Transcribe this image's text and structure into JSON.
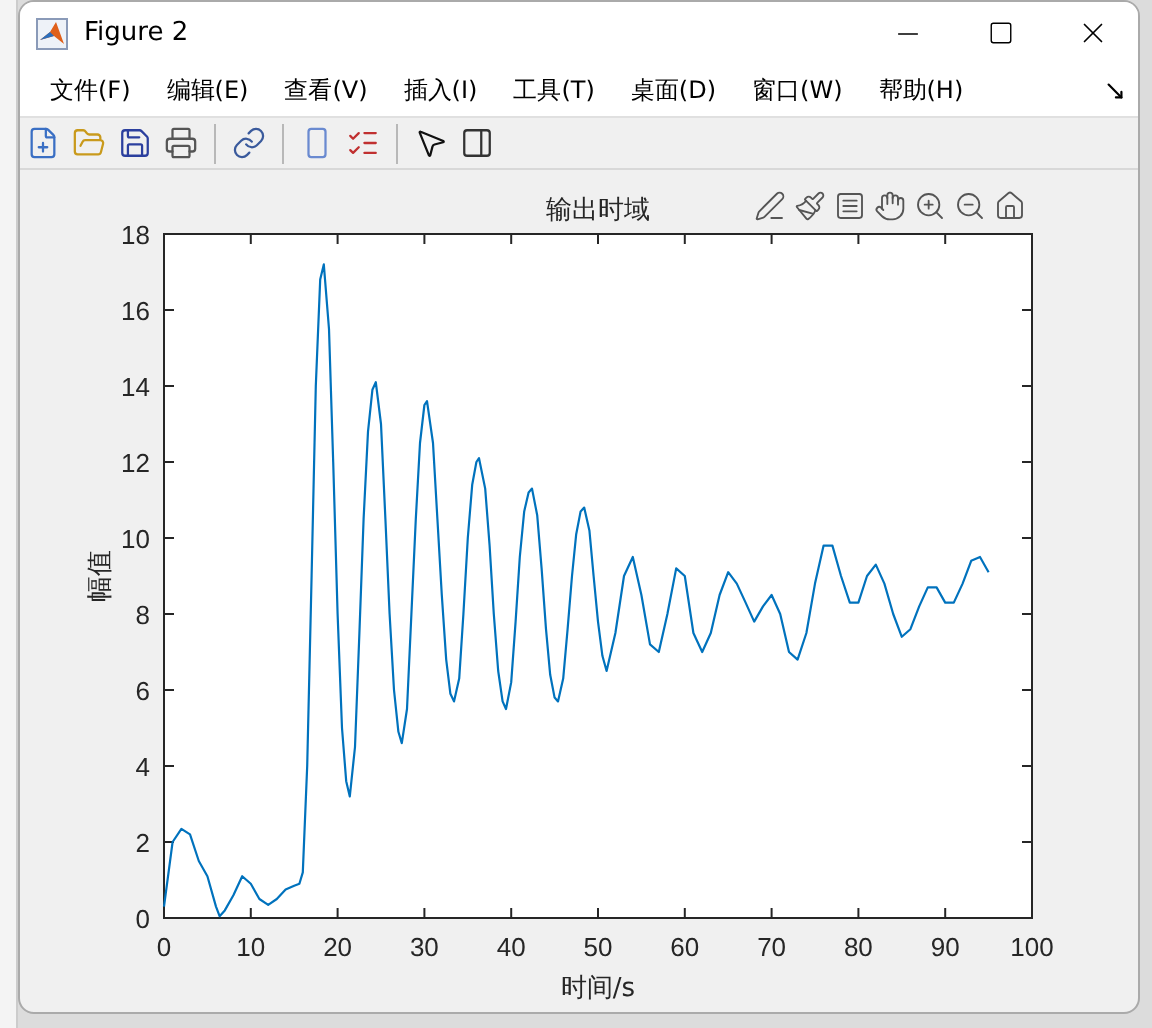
{
  "window": {
    "title": "Figure 2"
  },
  "menu": [
    {
      "label": "文件(F)"
    },
    {
      "label": "编辑(E)"
    },
    {
      "label": "查看(V)"
    },
    {
      "label": "插入(I)"
    },
    {
      "label": "工具(T)"
    },
    {
      "label": "桌面(D)"
    },
    {
      "label": "窗口(W)"
    },
    {
      "label": "帮助(H)"
    }
  ],
  "toolbar": [
    {
      "kind": "new"
    },
    {
      "kind": "open"
    },
    {
      "kind": "save"
    },
    {
      "kind": "print"
    },
    {
      "kind": "sep"
    },
    {
      "kind": "link"
    },
    {
      "kind": "sep"
    },
    {
      "kind": "colorbar"
    },
    {
      "kind": "legend"
    },
    {
      "kind": "sep"
    },
    {
      "kind": "pointer"
    },
    {
      "kind": "panel"
    }
  ],
  "axes_toolbar": [
    {
      "kind": "edit"
    },
    {
      "kind": "brush"
    },
    {
      "kind": "datatip"
    },
    {
      "kind": "pan"
    },
    {
      "kind": "zoomin"
    },
    {
      "kind": "zoomout"
    },
    {
      "kind": "home"
    }
  ],
  "figure": {
    "chart_data": {
      "type": "line",
      "title": "输出时域",
      "xlabel": "时间/s",
      "ylabel": "幅值",
      "xlim": [
        0,
        100
      ],
      "ylim": [
        0,
        18
      ],
      "xticks": [
        0,
        10,
        20,
        30,
        40,
        50,
        60,
        70,
        80,
        90,
        100
      ],
      "yticks": [
        0,
        2,
        4,
        6,
        8,
        10,
        12,
        14,
        16,
        18
      ],
      "x": [
        0,
        1,
        2,
        3,
        4,
        5,
        6,
        6.4,
        7,
        8,
        9,
        10,
        11,
        12,
        13,
        14,
        15,
        15.6,
        16,
        16.5,
        17,
        17.5,
        18,
        18.4,
        19,
        19.5,
        20,
        20.5,
        21,
        21.4,
        22,
        22.5,
        23,
        23.5,
        24,
        24.4,
        25,
        25.5,
        26,
        26.5,
        27,
        27.4,
        28,
        28.5,
        29,
        29.5,
        30,
        30.3,
        31,
        31.5,
        32,
        32.5,
        33,
        33.4,
        34,
        34.5,
        35,
        35.5,
        36,
        36.3,
        37,
        37.5,
        38,
        38.5,
        39,
        39.4,
        40,
        40.5,
        41,
        41.5,
        42,
        42.4,
        43,
        43.5,
        44,
        44.5,
        45,
        45.4,
        46,
        46.5,
        47,
        47.5,
        48,
        48.4,
        49,
        49.5,
        50,
        50.5,
        51,
        52,
        53,
        54,
        55,
        56,
        57,
        58,
        59,
        60,
        61,
        62,
        63,
        64,
        65,
        66,
        67,
        68,
        69,
        70,
        71,
        72,
        73,
        74,
        75,
        76,
        77,
        78,
        79,
        80,
        81,
        82,
        83,
        84,
        85,
        86,
        87,
        88,
        89,
        90,
        91,
        92,
        93,
        94,
        95
      ],
      "series": [
        {
          "color": "#0072bd",
          "values": [
            0.3,
            2.0,
            2.35,
            2.2,
            1.5,
            1.1,
            0.3,
            0.05,
            0.2,
            0.6,
            1.1,
            0.9,
            0.5,
            0.35,
            0.5,
            0.75,
            0.85,
            0.9,
            1.2,
            4,
            9,
            14,
            16.8,
            17.2,
            15.5,
            12,
            8,
            5,
            3.6,
            3.2,
            4.5,
            7.5,
            10.5,
            12.8,
            13.9,
            14.1,
            13,
            10.5,
            8,
            6,
            4.9,
            4.6,
            5.5,
            8,
            10.5,
            12.5,
            13.5,
            13.6,
            12.5,
            10.5,
            8.5,
            6.8,
            5.9,
            5.7,
            6.3,
            8,
            10,
            11.4,
            12,
            12.1,
            11.3,
            9.8,
            8,
            6.5,
            5.7,
            5.5,
            6.2,
            7.8,
            9.5,
            10.7,
            11.2,
            11.3,
            10.6,
            9.2,
            7.6,
            6.4,
            5.8,
            5.7,
            6.3,
            7.6,
            9,
            10.1,
            10.7,
            10.8,
            10.2,
            9,
            7.8,
            6.9,
            6.5,
            7.5,
            9,
            9.5,
            8.5,
            7.2,
            7,
            8,
            9.2,
            9,
            7.5,
            7,
            7.5,
            8.5,
            9.1,
            8.8,
            8.3,
            7.8,
            8.2,
            8.5,
            8,
            7,
            6.8,
            7.5,
            8.8,
            9.8,
            9.8,
            9,
            8.3,
            8.3,
            9,
            9.3,
            8.8,
            8,
            7.4,
            7.6,
            8.2,
            8.7,
            8.7,
            8.3,
            8.3,
            8.8,
            9.4,
            9.5,
            9.1
          ]
        }
      ]
    }
  }
}
